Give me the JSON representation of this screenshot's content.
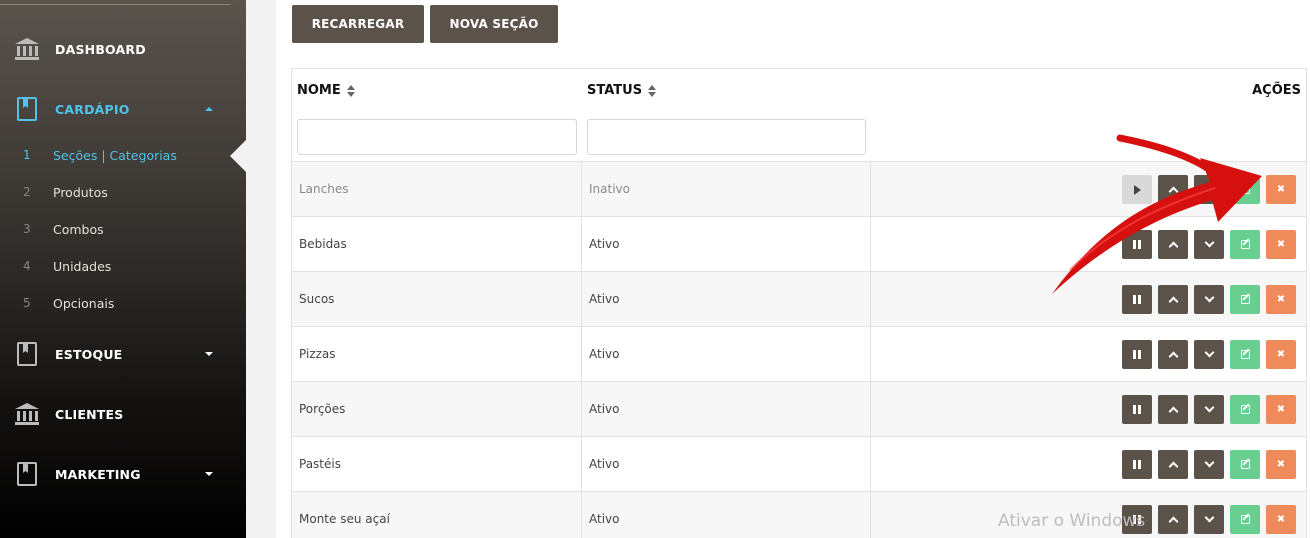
{
  "sidebar": {
    "items": [
      {
        "label": "DASHBOARD",
        "icon": "bank-icon"
      },
      {
        "label": "CARDÁPIO",
        "icon": "book-icon"
      },
      {
        "label": "ESTOQUE",
        "icon": "book-icon"
      },
      {
        "label": "CLIENTES",
        "icon": "bank-icon"
      },
      {
        "label": "MARKETING",
        "icon": "book-icon"
      }
    ],
    "submenu": [
      {
        "num": "1",
        "label": "Seções | Categorias"
      },
      {
        "num": "2",
        "label": "Produtos"
      },
      {
        "num": "3",
        "label": "Combos"
      },
      {
        "num": "4",
        "label": "Unidades"
      },
      {
        "num": "5",
        "label": "Opcionais"
      }
    ]
  },
  "toolbar": {
    "reload_label": "RECARREGAR",
    "new_section_label": "NOVA SEÇÃO"
  },
  "table": {
    "headers": {
      "name": "NOME",
      "status": "STATUS",
      "actions": "AÇÕES"
    },
    "rows": [
      {
        "name": "Lanches",
        "status": "Inativo"
      },
      {
        "name": "Bebidas",
        "status": "Ativo"
      },
      {
        "name": "Sucos",
        "status": "Ativo"
      },
      {
        "name": "Pizzas",
        "status": "Ativo"
      },
      {
        "name": "Porções",
        "status": "Ativo"
      },
      {
        "name": "Pastéis",
        "status": "Ativo"
      },
      {
        "name": "Monte seu açaí",
        "status": "Ativo"
      }
    ]
  },
  "colors": {
    "accent": "#4fc3e8",
    "button_dark": "#5b524a",
    "edit": "#68cf91",
    "delete": "#ef8a5b",
    "arrow": "#e01010"
  },
  "watermark": "Ativar o Windows"
}
